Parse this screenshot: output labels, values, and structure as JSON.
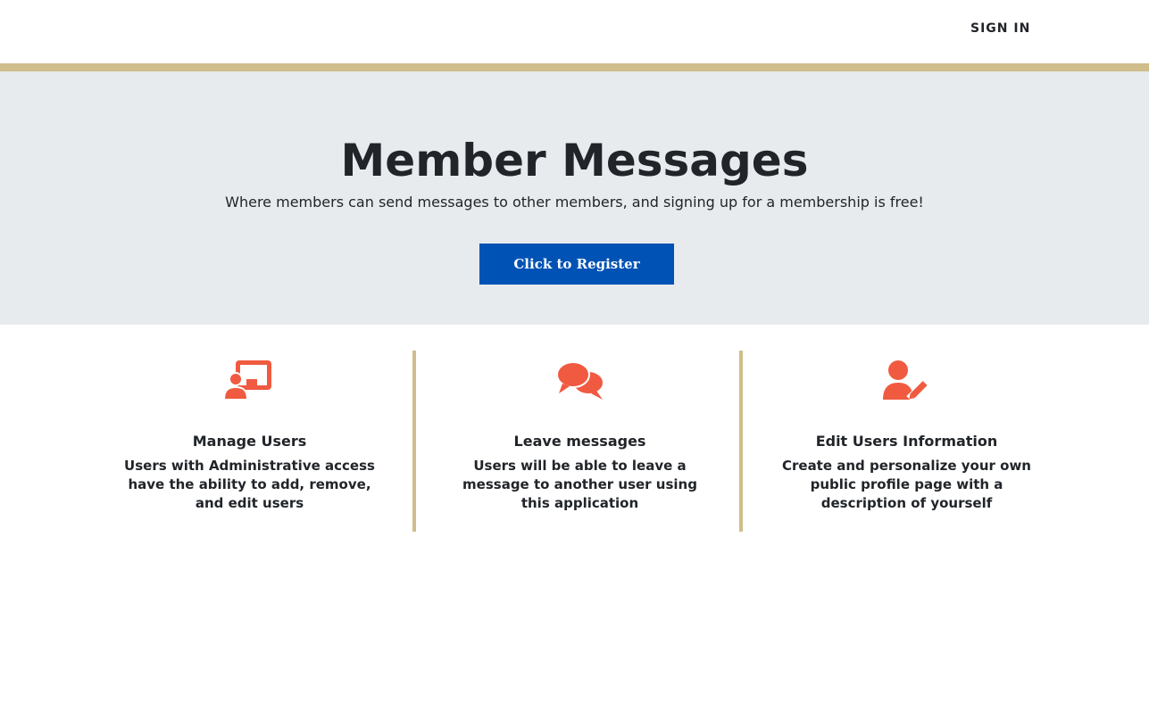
{
  "header": {
    "signin_label": "SIGN IN"
  },
  "hero": {
    "title": "Member Messages",
    "subtitle": "Where members can send messages to other members, and signing up for a membership is free!",
    "register_label": "Click to Register"
  },
  "features": [
    {
      "icon": "presenter-board-icon",
      "title": "Manage Users",
      "text": "Users with Administrative access have the ability to add, remove, and edit users"
    },
    {
      "icon": "chat-bubbles-icon",
      "title": "Leave messages",
      "text": "Users will be able to leave a message to another user using this application"
    },
    {
      "icon": "user-edit-icon",
      "title": "Edit Users Information",
      "text": "Create and personalize your own public profile page with a description of yourself"
    }
  ],
  "colors": {
    "accent_gold": "#cfbd8b",
    "hero_bg": "#e8ebee",
    "button_blue": "#0052b4",
    "icon_coral": "#f05a40"
  }
}
